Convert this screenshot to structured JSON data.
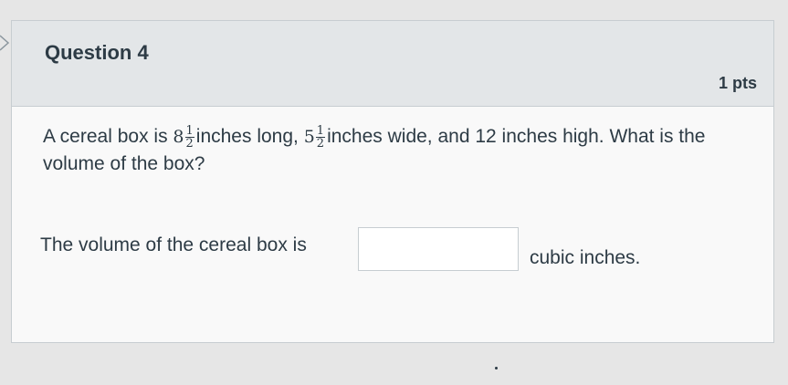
{
  "question": {
    "title": "Question 4",
    "points": "1 pts",
    "text": {
      "part1": "A cereal box is ",
      "whole1": "8",
      "frac1": {
        "num": "1",
        "den": "2"
      },
      "part2": "inches long, ",
      "whole2": "5",
      "frac2": {
        "num": "1",
        "den": "2"
      },
      "part3": "inches wide, and 12 inches high. What is the volume of the box?"
    },
    "answer": {
      "prefix": "The volume of the cereal box is",
      "value": "",
      "suffix": "cubic inches."
    }
  },
  "icons": {
    "collapse": "chevron-right-icon"
  },
  "colors": {
    "header_bg": "#e3e6e8",
    "card_bg": "#f9f9f9",
    "text": "#2d3b45",
    "border": "#c7cdd1"
  }
}
